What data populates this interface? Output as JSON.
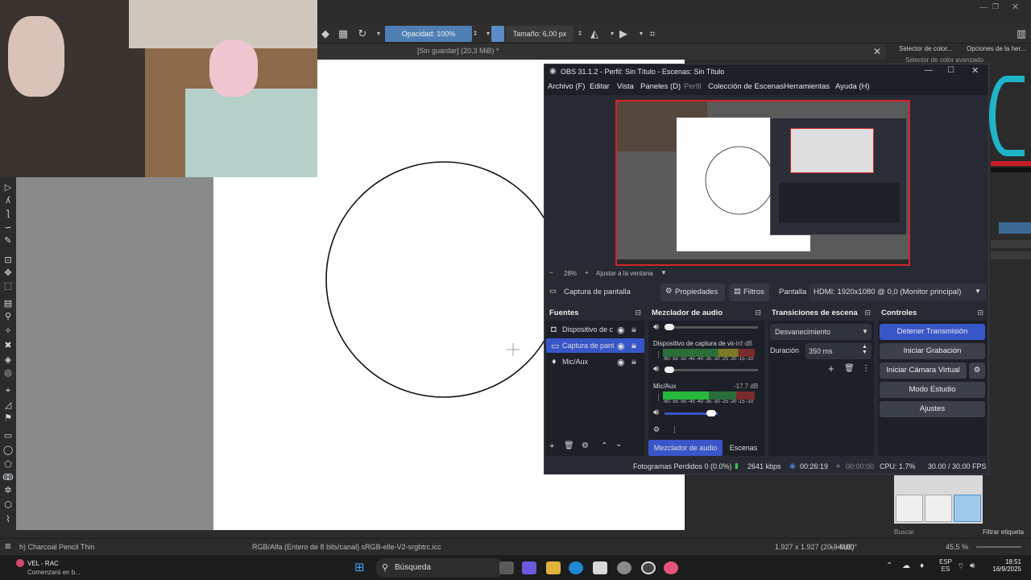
{
  "krita": {
    "toolbar": {
      "opacity_label": "Opacidad: 100%",
      "size_label": "Tamaño: 6,00 px"
    },
    "doc_tab": "[Sin guardar]  (20,3 MiB) *",
    "right_panel": {
      "tab1": "Selector de color...",
      "tab2": "Opciones de la her...",
      "advanced": "Selector de color avanzado",
      "search_placeholder": "Buscar",
      "filter_tag": "Filtrar etiqueta"
    },
    "statusbar": {
      "brush": "h) Charcoal Pencil Thin",
      "color_profile": "RGB/Alfa (Entero de 8 bits/canal)  sRGB-elle-V2-srgbtrc.icc",
      "dimensions": "1.927 x 1.927 (20,3 MiB)",
      "rotation": "0,00°",
      "zoom": "45,5 %"
    }
  },
  "obs": {
    "title": "OBS 31.1.2 - Perfil: Sin Título - Escenas: Sin Título",
    "menu": [
      "Archivo (F)",
      "Editar",
      "Vista",
      "Paneles (D)",
      "Perfil",
      "Colección de Escenas",
      "Herramientas",
      "Ayuda (H)"
    ],
    "zoom_pct": "28%",
    "fit_window": "Ajustar a la ventana",
    "source_bar": {
      "source_name": "Captura de pantalla",
      "properties": "Propiedades",
      "filters": "Filtros",
      "screen_label": "Pantalla",
      "screen_value": "HDMI: 1920x1080 @ 0,0 (Monitor principal)"
    },
    "docks": {
      "sources": {
        "title": "Fuentes",
        "items": [
          "Dispositivo de c",
          "Captura de pant",
          "Mic/Aux"
        ]
      },
      "mixer": {
        "title": "Mezclador de audio",
        "channels": [
          {
            "name": "Dispositivo de captura de vid",
            "level": "-inf dB"
          },
          {
            "name": "Mic/Aux",
            "level": "-17.7 dB"
          }
        ],
        "scale": "-60 -55 -50 -45 -40 -35 -30 -25 -20 -15 -10 -5  0"
      },
      "transitions": {
        "title": "Transiciones de escena",
        "type": "Desvanecimiento",
        "duration_label": "Duración",
        "duration_value": "350 ms"
      },
      "controls": {
        "title": "Controles",
        "stop_stream": "Detener Transmisión",
        "start_recording": "Iniciar Grabación",
        "virtual_cam": "Iniciar Cámara Virtual",
        "studio_mode": "Modo Estudio",
        "settings": "Ajustes"
      }
    },
    "bottom_tabs": [
      "Mezclador de audio",
      "Escenas"
    ],
    "status": {
      "dropped": "Fotogramas Perdidos 0 (0.0%)",
      "bitrate": "2641 kbps",
      "stream_time": "00:26:19",
      "rec_time": "00:00:00",
      "cpu": "CPU: 1.7%",
      "fps": "30.00 / 30.00 FPS"
    },
    "colors": {
      "accent": "#3956c9",
      "live_border": "#d4232a"
    }
  },
  "taskbar": {
    "notification_title": "VEL - RAC",
    "notification_sub": "Comenzará en b...",
    "search": "Búsqueda",
    "lang_top": "ESP",
    "lang_bottom": "ES",
    "time": "18:51",
    "date": "16/9/2025"
  }
}
